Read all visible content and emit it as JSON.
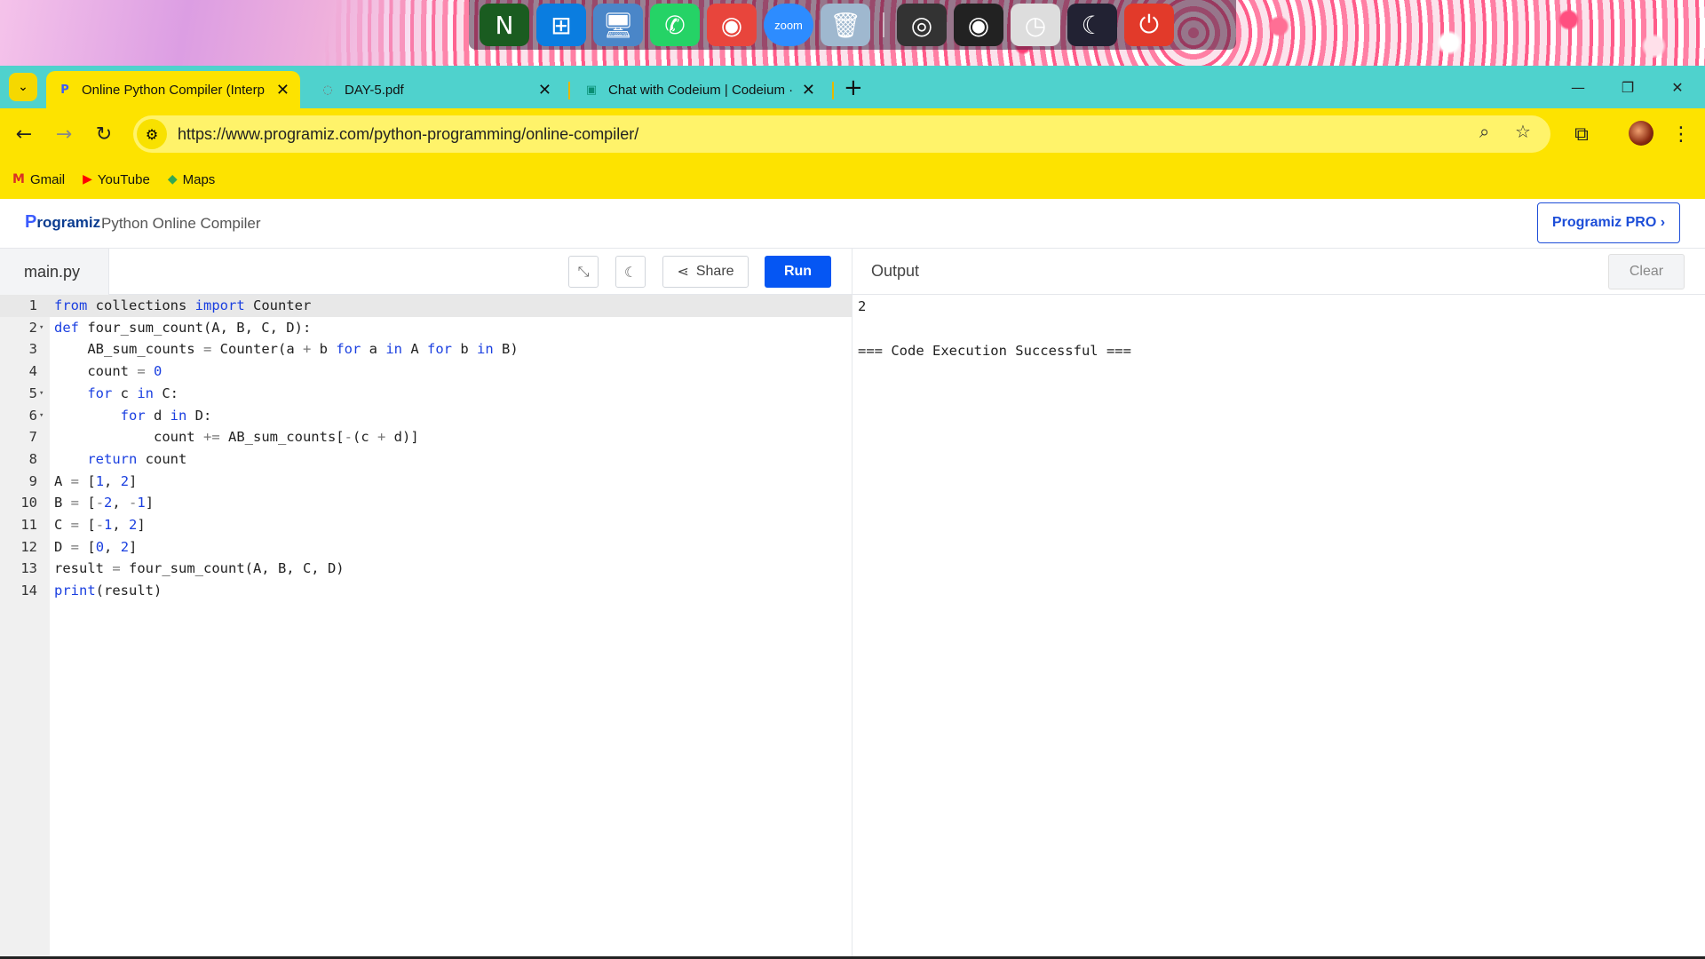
{
  "dock": {
    "icons": [
      {
        "name": "nexus-icon",
        "glyph": "N",
        "bg": "#1a5c20"
      },
      {
        "name": "windows-icon",
        "glyph": "⊞",
        "bg": "#0a7de0"
      },
      {
        "name": "computer-icon",
        "glyph": "🖥",
        "bg": "#4a86c8"
      },
      {
        "name": "whatsapp-icon",
        "glyph": "✆",
        "bg": "#25d366"
      },
      {
        "name": "chrome-icon",
        "glyph": "◉",
        "bg": "#e8453c"
      },
      {
        "name": "zoom-icon",
        "glyph": "zoom",
        "bg": "#2d8cff"
      },
      {
        "name": "recycle-bin-icon",
        "glyph": "🗑",
        "bg": "#9fb8cf"
      },
      {
        "name": "speaker-icon",
        "glyph": "◎",
        "bg": "#333"
      },
      {
        "name": "camera-icon",
        "glyph": "◉",
        "bg": "#222"
      },
      {
        "name": "clock-icon",
        "glyph": "◷",
        "bg": "#ddd"
      },
      {
        "name": "monitor-moon-icon",
        "glyph": "☾",
        "bg": "#223"
      },
      {
        "name": "power-icon",
        "glyph": "⏻",
        "bg": "#e23a2a"
      }
    ]
  },
  "browser": {
    "tabs": [
      {
        "title": "Online Python Compiler (Interp",
        "favicon": "P",
        "active": true
      },
      {
        "title": "DAY-5.pdf",
        "favicon": "◌",
        "active": false
      },
      {
        "title": "Chat with Codeium | Codeium ·",
        "favicon": "▣",
        "active": false
      }
    ],
    "close_glyph": "✕",
    "new_tab_glyph": "+",
    "url": "https://www.programiz.com/python-programming/online-compiler/",
    "bookmarks": [
      {
        "label": "Gmail",
        "icon": "M",
        "color": "#d93025"
      },
      {
        "label": "YouTube",
        "icon": "▶",
        "color": "#ff0000"
      },
      {
        "label": "Maps",
        "icon": "◆",
        "color": "#34a853"
      }
    ]
  },
  "site": {
    "logo_p": "P",
    "logo_rest": "rogramiz",
    "subtitle": "Python Online Compiler",
    "pro_button": "Programiz PRO ›"
  },
  "editor": {
    "file_name": "main.py",
    "share_label": "Share",
    "run_label": "Run",
    "lines": [
      {
        "n": 1,
        "fold": false,
        "html": "<span class=\"kw\">from</span> collections <span class=\"kw\">import</span> Counter"
      },
      {
        "n": 2,
        "fold": true,
        "html": "<span class=\"kw\">def</span> four_sum_count(A, B, C, D):"
      },
      {
        "n": 3,
        "fold": false,
        "html": "    AB_sum_counts <span class=\"op\">=</span> Counter(a <span class=\"op\">+</span> b <span class=\"kw\">for</span> a <span class=\"kw\">in</span> A <span class=\"kw\">for</span> b <span class=\"kw\">in</span> B)"
      },
      {
        "n": 4,
        "fold": false,
        "html": "    count <span class=\"op\">=</span> <span class=\"num\">0</span>"
      },
      {
        "n": 5,
        "fold": true,
        "html": "    <span class=\"kw\">for</span> c <span class=\"kw\">in</span> C:"
      },
      {
        "n": 6,
        "fold": true,
        "html": "        <span class=\"kw\">for</span> d <span class=\"kw\">in</span> D:"
      },
      {
        "n": 7,
        "fold": false,
        "html": "            count <span class=\"op\">+=</span> AB_sum_counts[<span class=\"op\">-</span>(c <span class=\"op\">+</span> d)]"
      },
      {
        "n": 8,
        "fold": false,
        "html": "    <span class=\"kw\">return</span> count"
      },
      {
        "n": 9,
        "fold": false,
        "html": "A <span class=\"op\">=</span> [<span class=\"num\">1</span>, <span class=\"num\">2</span>]"
      },
      {
        "n": 10,
        "fold": false,
        "html": "B <span class=\"op\">=</span> [<span class=\"op\">-</span><span class=\"num\">2</span>, <span class=\"op\">-</span><span class=\"num\">1</span>]"
      },
      {
        "n": 11,
        "fold": false,
        "html": "C <span class=\"op\">=</span> [<span class=\"op\">-</span><span class=\"num\">1</span>, <span class=\"num\">2</span>]"
      },
      {
        "n": 12,
        "fold": false,
        "html": "D <span class=\"op\">=</span> [<span class=\"num\">0</span>, <span class=\"num\">2</span>]"
      },
      {
        "n": 13,
        "fold": false,
        "html": "result <span class=\"op\">=</span> four_sum_count(A, B, C, D)"
      },
      {
        "n": 14,
        "fold": false,
        "html": "<span class=\"kw\">print</span>(result)"
      }
    ]
  },
  "output": {
    "label": "Output",
    "clear_label": "Clear",
    "lines": [
      "2",
      "",
      "=== Code Execution Successful ==="
    ]
  },
  "colors": {
    "accent": "#0556f3",
    "tabstrip": "#4fd2cd",
    "toolbar": "#fde300"
  }
}
